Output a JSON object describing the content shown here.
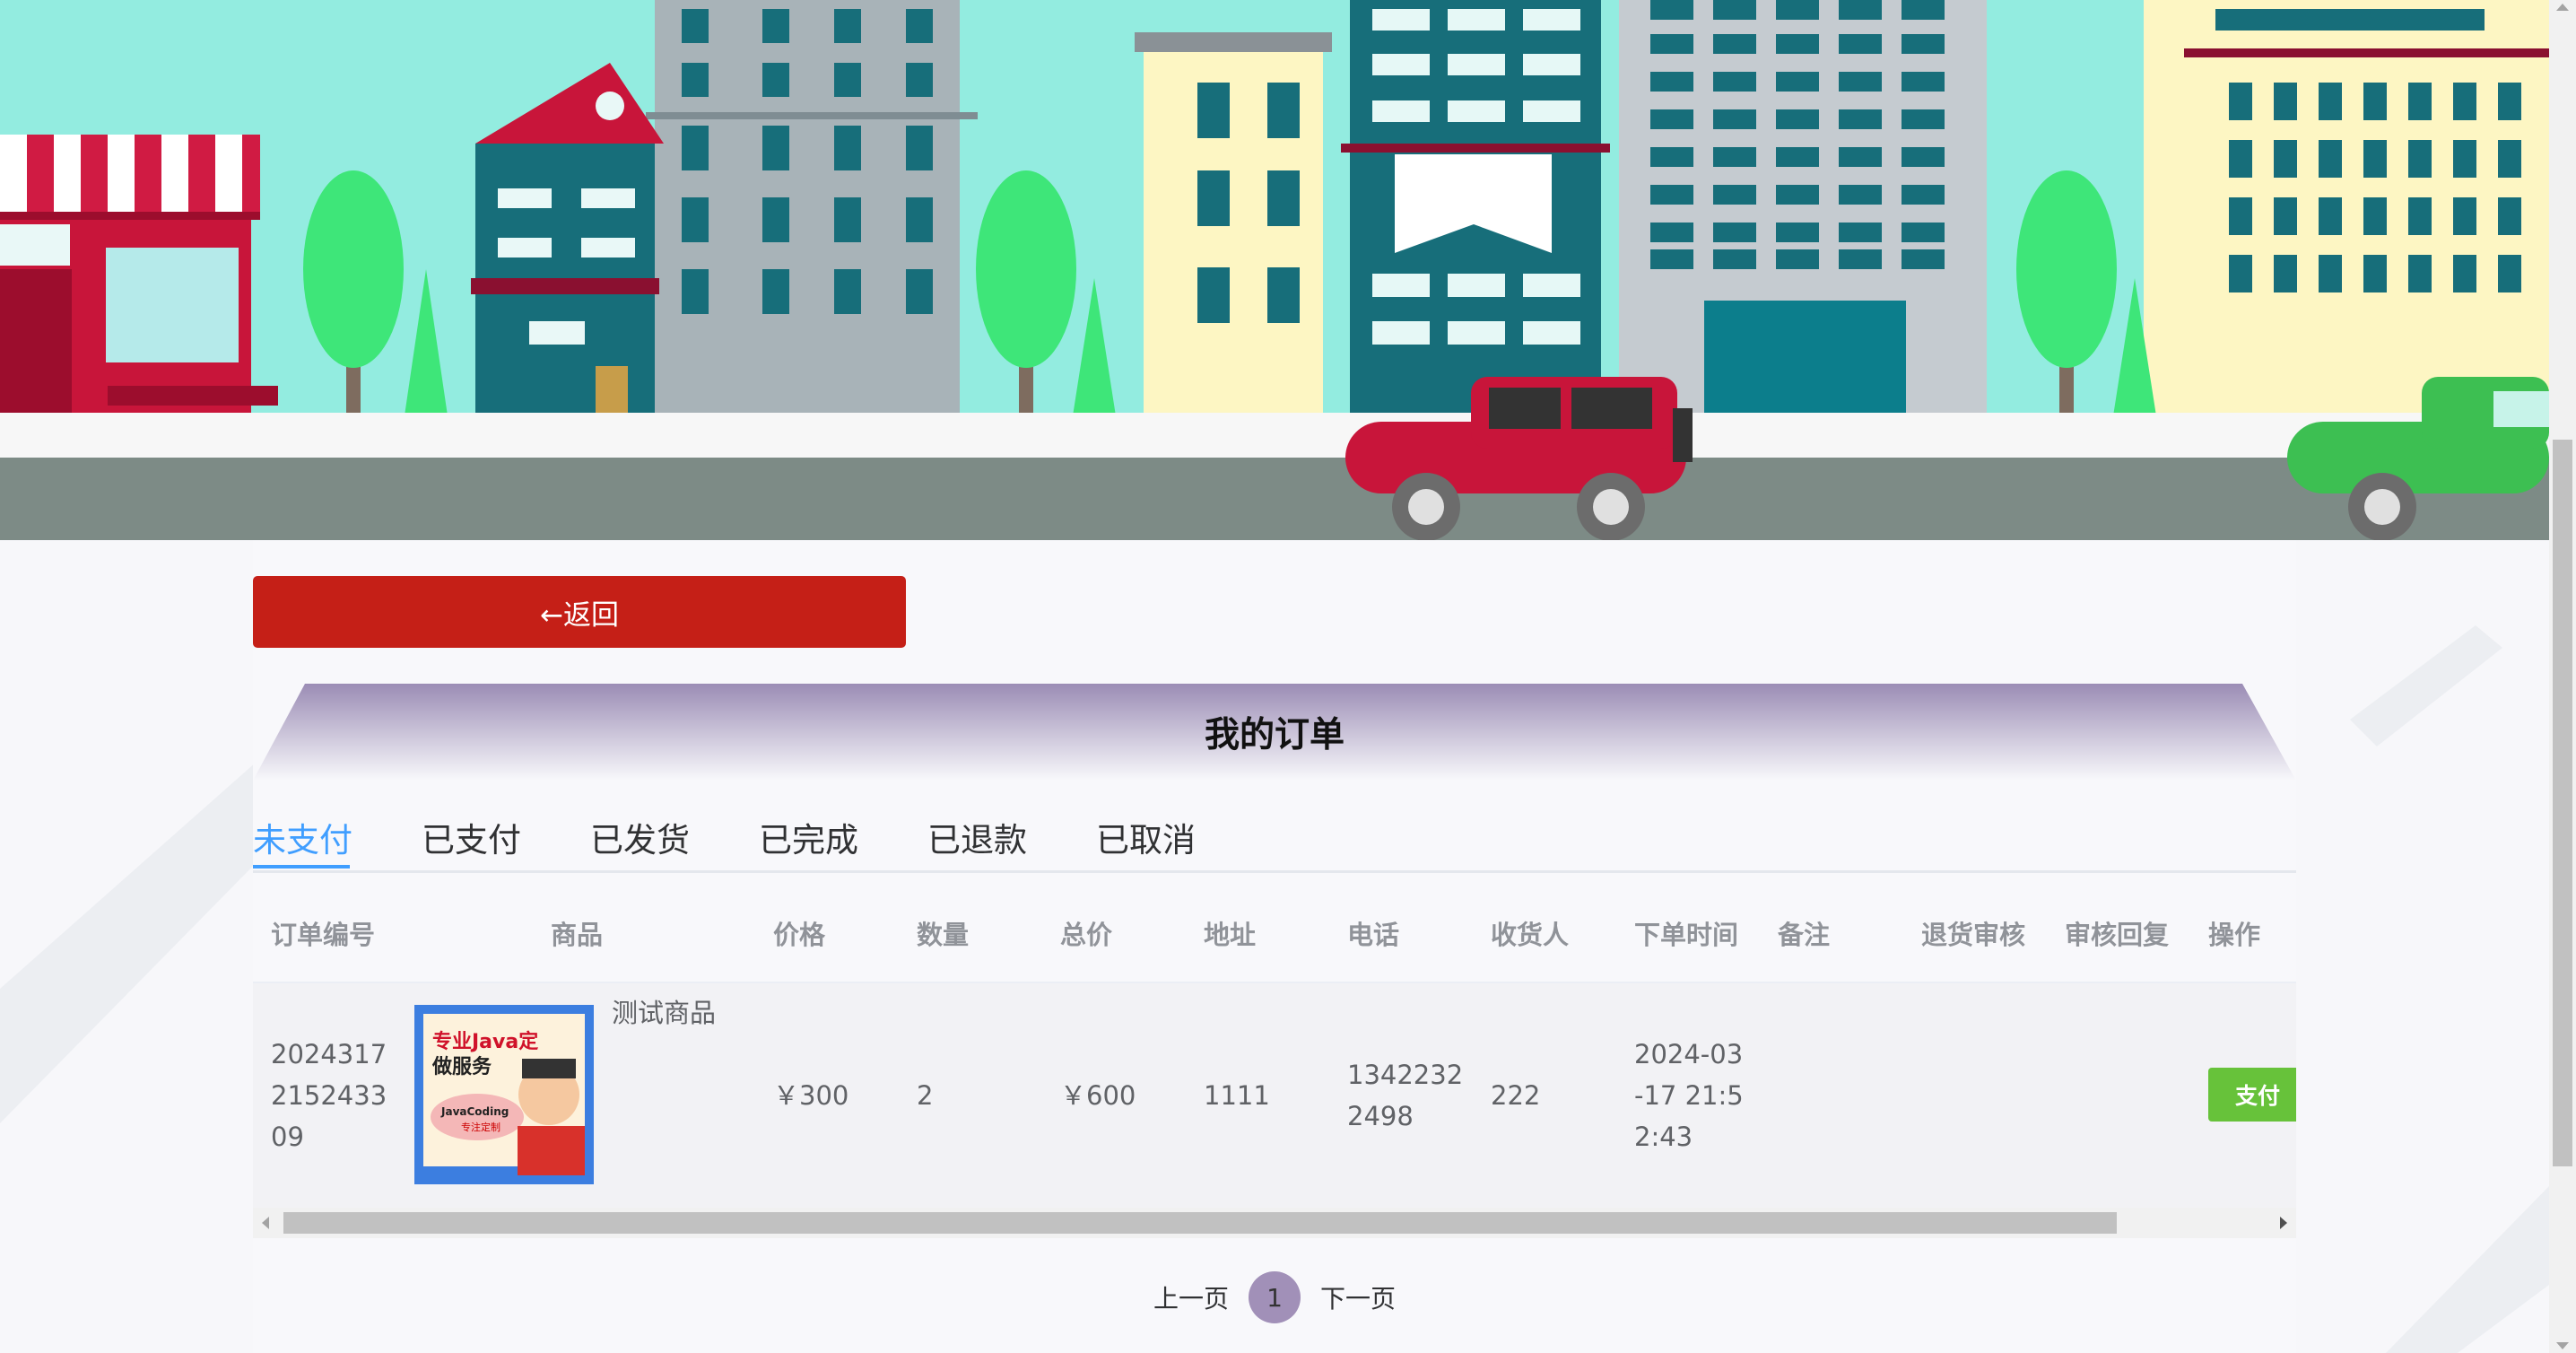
{
  "header": {
    "back_label": "←返回",
    "page_title": "我的订单"
  },
  "tabs": [
    {
      "label": "未支付",
      "active": true
    },
    {
      "label": "已支付",
      "active": false
    },
    {
      "label": "已发货",
      "active": false
    },
    {
      "label": "已完成",
      "active": false
    },
    {
      "label": "已退款",
      "active": false
    },
    {
      "label": "已取消",
      "active": false
    }
  ],
  "table": {
    "columns": [
      "订单编号",
      "商品",
      "价格",
      "数量",
      "总价",
      "地址",
      "电话",
      "收货人",
      "下单时间",
      "备注",
      "退货审核",
      "审核回复",
      "操作"
    ],
    "rows": [
      {
        "order_no": "2024317\n2152433\n09",
        "product_name": "测试商品",
        "product_image_text": [
          "专业Java定",
          "做服务",
          "JavaCoding",
          "专注定制"
        ],
        "price": "￥300",
        "quantity": "2",
        "total": "￥600",
        "address": "1111",
        "phone": "1342232\n2498",
        "receiver": "222",
        "order_time": "2024-03\n-17 21:5\n2:43",
        "note": "",
        "return_review": "",
        "review_reply": "",
        "action_label": "支付"
      }
    ]
  },
  "pagination": {
    "prev": "上一页",
    "current": "1",
    "next": "下一页"
  },
  "colors": {
    "back_button": "#c51f17",
    "active_tab": "#409eff",
    "pay_button": "#67c23a",
    "page_current": "#a190b8",
    "title_gradient_top": "#9b8cb5"
  },
  "icons": {
    "back": "left-arrow",
    "scroll": "scrollbar-arrows"
  }
}
